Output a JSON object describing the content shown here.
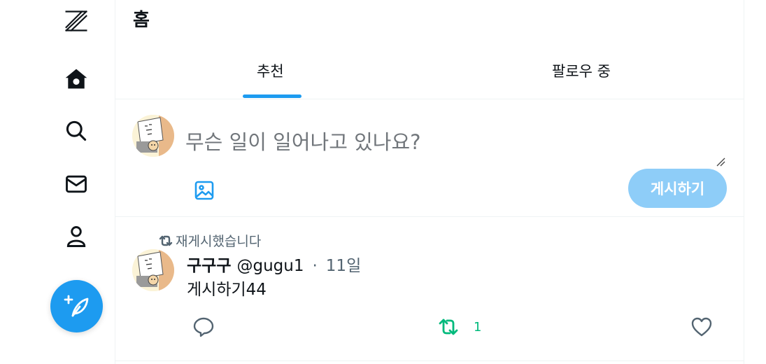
{
  "header": {
    "title": "홈"
  },
  "tabs": [
    {
      "label": "추천",
      "active": true
    },
    {
      "label": "팔로우 중",
      "active": false
    }
  ],
  "sidebar": {
    "items": [
      {
        "icon": "logo-z-icon"
      },
      {
        "icon": "home-icon"
      },
      {
        "icon": "search-icon"
      },
      {
        "icon": "mail-icon"
      },
      {
        "icon": "profile-icon"
      }
    ],
    "compose_icon": "feather-plus-icon"
  },
  "composer": {
    "placeholder": "무슨 일이 일어나고 있나요?",
    "value": "",
    "media_icon": "image-icon",
    "post_label": "게시하기"
  },
  "post": {
    "repost_label": "재게시했습니다",
    "author_name": "구구구",
    "author_handle": "@gugu1",
    "separator": "·",
    "time": "11일",
    "text": "게시하기44",
    "repost_count": "1"
  },
  "colors": {
    "accent": "#1d9bf0",
    "accent_disabled": "#8ecdf8",
    "repost_green": "#00ba7c",
    "muted": "#536471",
    "border": "#eff3f4"
  }
}
